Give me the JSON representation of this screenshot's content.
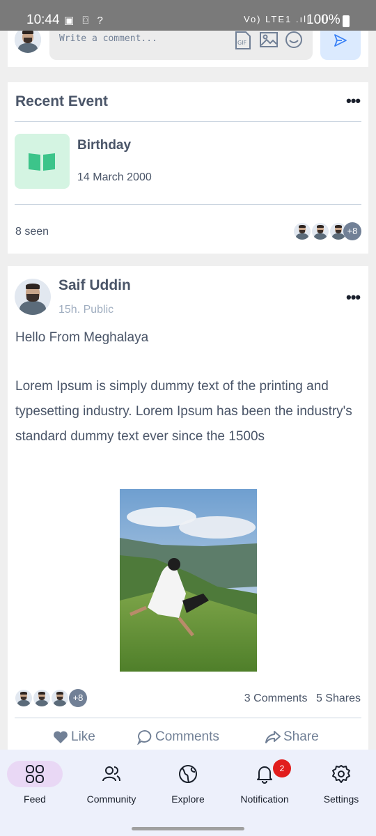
{
  "status_bar": {
    "time": "10:44",
    "left_icons": "▣ ⌼ ?",
    "right_icons": "Vo) LTE1 .ıll .ıll",
    "battery_percent": "100%"
  },
  "comment_composer": {
    "placeholder": "Write a comment...",
    "gif_label": "GIF"
  },
  "recent_event": {
    "title": "Recent Event",
    "event_name": "Birthday",
    "event_date": "14 March 2000",
    "seen": "8 seen",
    "more_viewers": "+8",
    "icon_color": "#3cc48a"
  },
  "post": {
    "author": "Saif Uddin",
    "meta": "15h. Public",
    "heading": "Hello From Meghalaya",
    "body": "Lorem Ipsum is simply dummy text of the printing and typesetting industry. Lorem Ipsum has been the industry's standard dummy text ever since the 1500s",
    "more_reactors": "+8",
    "comments_count": "3 Comments",
    "shares_count": "5 Shares",
    "actions": {
      "like": "Like",
      "comments": "Comments",
      "share": "Share"
    }
  },
  "bottom_nav": {
    "items": [
      {
        "label": "Feed",
        "icon": "grid-icon",
        "active": true
      },
      {
        "label": "Community",
        "icon": "users-icon",
        "active": false
      },
      {
        "label": "Explore",
        "icon": "globe-icon",
        "active": false
      },
      {
        "label": "Notification",
        "icon": "bell-icon",
        "active": false
      },
      {
        "label": "Settings",
        "icon": "gear-icon",
        "active": false
      }
    ],
    "notification_badge": "2"
  },
  "colors": {
    "accent": "#3b82f6",
    "nav_active_bg": "#e9d8f5",
    "badge": "#e11d1d",
    "event_icon_bg": "#d4f4e2"
  }
}
